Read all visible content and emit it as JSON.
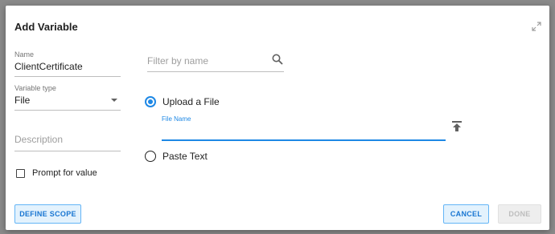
{
  "dialog": {
    "title": "Add Variable"
  },
  "name_field": {
    "label": "Name",
    "value": "ClientCertificate"
  },
  "variable_type": {
    "label": "Variable type",
    "value": "File"
  },
  "description": {
    "placeholder": "Description"
  },
  "prompt": {
    "label": "Prompt for value",
    "checked": false
  },
  "filter": {
    "placeholder": "Filter by name"
  },
  "upload_option": {
    "label": "Upload a File",
    "selected": true,
    "file_name_label": "File Name"
  },
  "paste_option": {
    "label": "Paste Text",
    "selected": false
  },
  "buttons": {
    "define_scope": "DEFINE SCOPE",
    "cancel": "CANCEL",
    "done": "DONE"
  },
  "colors": {
    "accent": "#1e88e5",
    "button_bg": "#e3f2fd",
    "disabled_bg": "#eeeeee"
  },
  "icons": [
    "expand-icon",
    "search-icon",
    "upload-icon",
    "chevron-down-icon"
  ]
}
